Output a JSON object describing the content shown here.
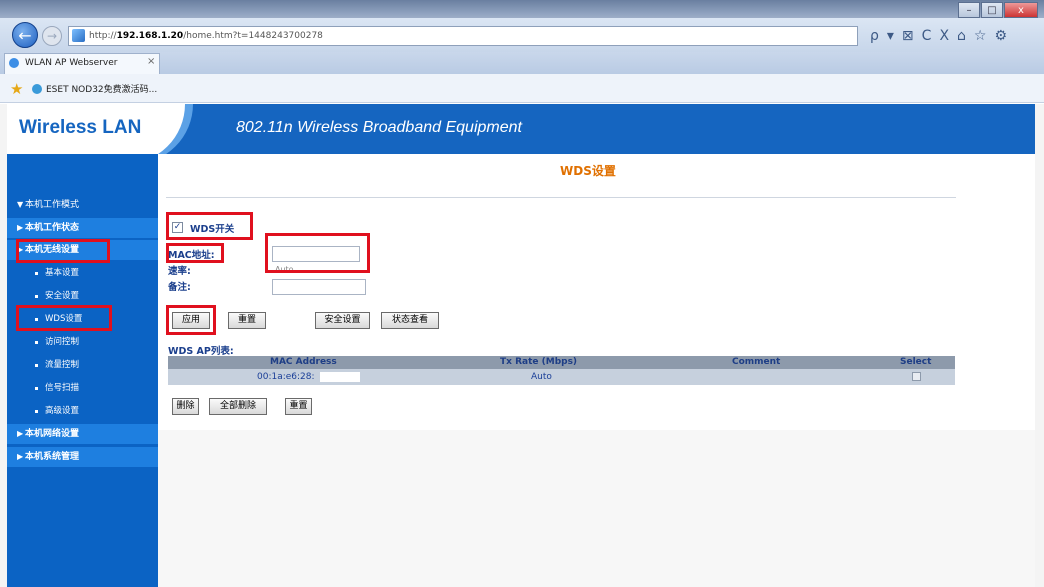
{
  "browser": {
    "address_scheme": "http://",
    "address_host": "192.168.1.20",
    "address_path": "/home.htm?t=1448243700278",
    "tab_title": "WLAN AP Webserver",
    "tab_close": "×",
    "favorite": "ESET NOD32免费激活码...",
    "tools": [
      "ρ",
      "▾",
      "⊠",
      "C",
      "X",
      "⌂",
      "☆",
      "⚙"
    ],
    "win_buttons": [
      "–",
      "□",
      "x"
    ]
  },
  "header": {
    "logo": "Wireless LAN",
    "title": "802.11n Wireless Broadband Equipment"
  },
  "sidebar": {
    "items": [
      {
        "label": "本机工作模式",
        "kind": "head",
        "arrow": "▼"
      },
      {
        "label": "本机工作状态",
        "kind": "top",
        "arrow": "▶"
      },
      {
        "label": "本机无线设置",
        "kind": "top",
        "arrow": "▶"
      },
      {
        "label": "基本设置",
        "kind": "sub"
      },
      {
        "label": "安全设置",
        "kind": "sub"
      },
      {
        "label": "WDS设置",
        "kind": "sub"
      },
      {
        "label": "访问控制",
        "kind": "sub"
      },
      {
        "label": "流量控制",
        "kind": "sub"
      },
      {
        "label": "信号扫描",
        "kind": "sub"
      },
      {
        "label": "高级设置",
        "kind": "sub"
      },
      {
        "label": "本机网络设置",
        "kind": "top",
        "arrow": "▶"
      },
      {
        "label": "本机系统管理",
        "kind": "top",
        "arrow": "▶"
      }
    ]
  },
  "main": {
    "title": "WDS设置",
    "wds_switch_label": "WDS开关",
    "wds_switch_checked": true,
    "checkmark": "✓",
    "mac_label": "MAC地址:",
    "mac_value": "",
    "rate_label": "速率:",
    "rate_value": "Auto",
    "note_label": "备注:",
    "note_value": "",
    "buttons": {
      "apply": "应用",
      "reset": "重置",
      "security": "安全设置",
      "status": "状态查看"
    },
    "list_title": "WDS AP列表:",
    "table": {
      "headers": [
        "MAC Address",
        "Tx Rate (Mbps)",
        "Comment",
        "Select"
      ],
      "rows": [
        {
          "mac": "00:1a:e6:28:",
          "rate": "Auto",
          "comment": ""
        }
      ]
    },
    "list_buttons": {
      "delete": "删除",
      "delete_all": "全部删除",
      "reset": "重置"
    }
  },
  "colors": {
    "accent_blue": "#1565c0",
    "title_orange": "#e07000",
    "highlight_red": "#e0101e"
  }
}
